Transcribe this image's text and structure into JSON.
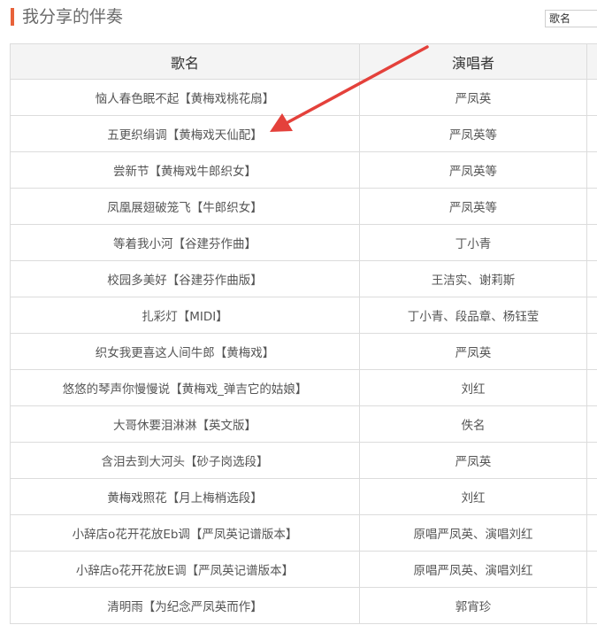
{
  "header": {
    "title": "我分享的伴奏",
    "search_select_value": "歌名",
    "accent_color": "#e8623a"
  },
  "table": {
    "columns": [
      "歌名",
      "演唱者"
    ],
    "rows": [
      {
        "title": "恼人春色眠不起【黄梅戏桃花扇】",
        "singer": "严凤英"
      },
      {
        "title": "五更织绢调【黄梅戏天仙配】",
        "singer": "严凤英等"
      },
      {
        "title": "尝新节【黄梅戏牛郎织女】",
        "singer": "严凤英等"
      },
      {
        "title": "凤凰展翅破笼飞【牛郎织女】",
        "singer": "严凤英等"
      },
      {
        "title": "等着我小河【谷建芬作曲】",
        "singer": "丁小青"
      },
      {
        "title": "校园多美好【谷建芬作曲版】",
        "singer": "王洁实、谢莉斯"
      },
      {
        "title": "扎彩灯【MIDI】",
        "singer": "丁小青、段品章、杨钰莹"
      },
      {
        "title": "织女我更喜这人间牛郎【黄梅戏】",
        "singer": "严凤英"
      },
      {
        "title": "悠悠的琴声你慢慢说【黄梅戏_弹吉它的姑娘】",
        "singer": "刘红"
      },
      {
        "title": "大哥休要泪淋淋【英文版】",
        "singer": "佚名"
      },
      {
        "title": "含泪去到大河头【砂子岗选段】",
        "singer": "严凤英"
      },
      {
        "title": "黄梅戏照花【月上梅梢选段】",
        "singer": "刘红"
      },
      {
        "title": "小辞店o花开花放Eb调【严凤英记谱版本】",
        "singer": "原唱严凤英、演唱刘红"
      },
      {
        "title": "小辞店o花开花放E调【严凤英记谱版本】",
        "singer": "原唱严凤英、演唱刘红"
      },
      {
        "title": "清明雨【为纪念严凤英而作】",
        "singer": "郭宵珍"
      }
    ]
  },
  "annotation": {
    "arrow_color": "#e4413b"
  }
}
